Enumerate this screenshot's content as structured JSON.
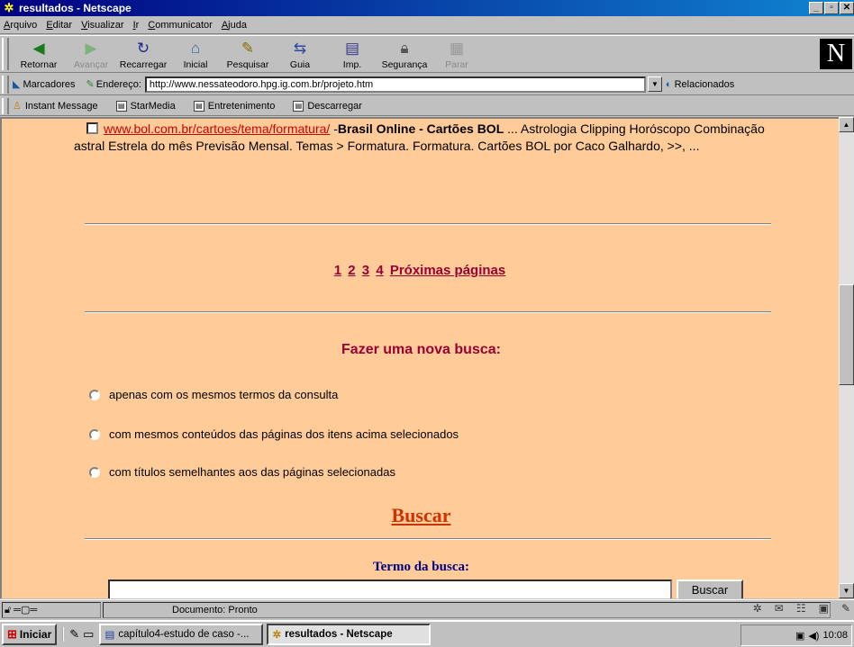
{
  "window": {
    "title": "resultados - Netscape",
    "controls": [
      "_",
      "▫",
      "✕"
    ]
  },
  "menu": [
    "Arquivo",
    "Editar",
    "Visualizar",
    "Ir",
    "Communicator",
    "Ajuda"
  ],
  "toolbar": {
    "back": "Retornar",
    "forward": "Avançar",
    "reload": "Recarregar",
    "home": "Inicial",
    "search": "Pesquisar",
    "guide": "Guia",
    "print": "Imp.",
    "security": "Segurança",
    "stop": "Parar"
  },
  "location": {
    "bookmarks": "Marcadores",
    "address_label": "Endereço:",
    "url": "http://www.nessateodoro.hpg.ig.com.br/projeto.htm",
    "related": "Relacionados"
  },
  "personal": [
    "Instant Message",
    "StarMedia",
    "Entretenimento",
    "Descarregar"
  ],
  "content": {
    "result_link": "www.bol.com.br/cartoes/tema/formatura/",
    "result_dash": " -",
    "result_title": "Brasil Online - Cartões BOL",
    "result_snippet": " ... Astrologia Clipping Horóscopo Combinação astral Estrela do mês Previsão Mensal. Temas > Formatura. Formatura. Cartões BOL por Caco Galhardo, >>, ...",
    "pages": [
      "1",
      "2",
      "3",
      "4"
    ],
    "next_pages": "Próximas páginas",
    "new_search": "Fazer uma nova busca:",
    "options": [
      "apenas com os mesmos termos da consulta",
      "com mesmos conteúdos das páginas dos itens acima selecionados",
      "com títulos semelhantes aos das páginas selecionadas"
    ],
    "buscar_heading": "Buscar",
    "term_label": "Termo da busca:",
    "search_value": "",
    "search_button": "Buscar"
  },
  "status": {
    "message": "Documento: Pronto"
  },
  "taskbar": {
    "start": "Iniciar",
    "tasks": [
      "capítulo4-estudo de caso -...",
      "resultados - Netscape"
    ],
    "clock": "10:08"
  }
}
